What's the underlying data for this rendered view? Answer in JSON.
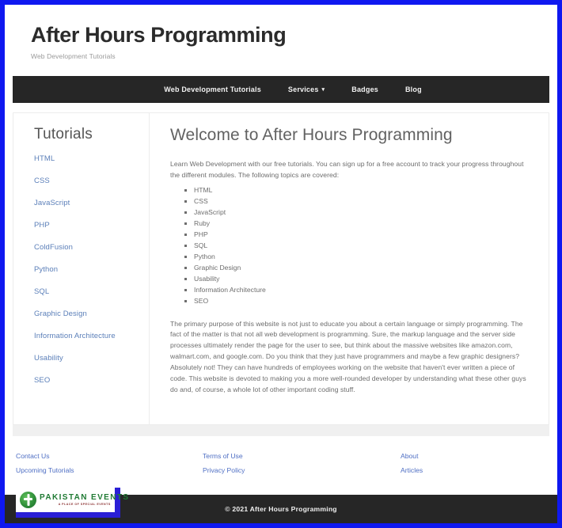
{
  "site": {
    "title": "After Hours Programming",
    "subtitle": "Web Development Tutorials"
  },
  "nav": {
    "items": [
      {
        "label": "Web Development Tutorials",
        "has_dropdown": false
      },
      {
        "label": "Services",
        "has_dropdown": true,
        "chevron": "chevron-down-icon"
      },
      {
        "label": "Badges",
        "has_dropdown": false
      },
      {
        "label": "Blog",
        "has_dropdown": false
      }
    ]
  },
  "sidebar": {
    "title": "Tutorials",
    "items": [
      {
        "label": "HTML"
      },
      {
        "label": "CSS"
      },
      {
        "label": "JavaScript"
      },
      {
        "label": "PHP"
      },
      {
        "label": "ColdFusion"
      },
      {
        "label": "Python"
      },
      {
        "label": "SQL"
      },
      {
        "label": "Graphic Design"
      },
      {
        "label": "Information Architecture"
      },
      {
        "label": "Usability"
      },
      {
        "label": "SEO"
      }
    ]
  },
  "main": {
    "heading": "Welcome to After Hours Programming",
    "intro": "Learn Web Development with our free tutorials. You can sign up for a free account to track your progress throughout the different modules. The following topics are covered:",
    "topics": [
      "HTML",
      "CSS",
      "JavaScript",
      "Ruby",
      "PHP",
      "SQL",
      "Python",
      "Graphic Design",
      "Usability",
      "Information Architecture",
      "SEO"
    ],
    "body": "The primary purpose of this website is not just to educate you about a certain language or simply programming. The fact of the matter is that not all web development is programming. Sure, the markup language and the server side processes ultimately render the page for the user to see, but think about the massive websites like amazon.com, walmart.com, and google.com. Do you think that they just have programmers and maybe a few graphic designers? Absolutely not! They can have hundreds of employees working on the website that haven't ever written a piece of code. This website is devoted to making you a more well-rounded developer by understanding what these other guys do and, of course, a whole lot of other important coding stuff."
  },
  "footer": {
    "columns": [
      {
        "links": [
          {
            "label": "Contact Us"
          },
          {
            "label": "Upcoming Tutorials"
          }
        ]
      },
      {
        "links": [
          {
            "label": "Terms of Use"
          },
          {
            "label": "Privacy Policy"
          }
        ]
      },
      {
        "links": [
          {
            "label": "About"
          },
          {
            "label": "Articles"
          }
        ]
      }
    ],
    "copyright": "© 2021 After Hours Programming"
  },
  "badge": {
    "name": "PAKISTAN EVENTS",
    "tagline": "A PLACE OF SPECIAL EVENTS",
    "emblem": "shield-icon"
  },
  "colors": {
    "border_frame": "#0f18f0",
    "nav_bar": "#262626",
    "link_blue": "#5b7fb9",
    "footer_link_blue": "#4f6fc4",
    "badge_green": "#1f7a33",
    "badge_frame": "#2a1fd6"
  }
}
